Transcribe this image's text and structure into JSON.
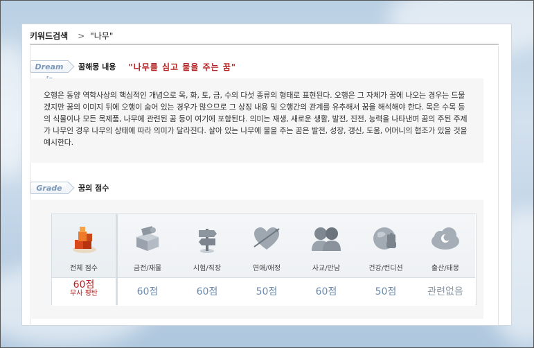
{
  "breadcrumb": {
    "root": "키워드검색",
    "separator": ">",
    "current": "\"나무\""
  },
  "dream": {
    "tag": "Dream is",
    "label": "꿈해몽 내용",
    "title": "\"나무를 심고 물을 주는 꿈\""
  },
  "description": "오행은 동양 역학사상의 핵심적인 개념으로 목, 화, 토, 금, 수의 다섯 종류의 형태로 표현된다. 오행은 그 자체가 꿈에 나오는 경우는 드물겠지만 꿈의 이미지 뒤에 오행이 숨어 있는 경우가 많으므로 그 상징 내용 및 오행간의 관계를 유추해서 꿈을 해석해야 한다. 목은 수목 등의 식물이나 모든 목제품, 나무에 관련된 꿈 등이 여기에 포함된다. 의미는 재생, 새로운 생활, 발전, 진전, 능력을 나타낸며 꿈의 주된 주제가 나무인 경우 나무의 상태에 따라 의미가 달라진다. 살아 있는 나무에 물을 주는 꿈은 발전, 성장, 갱신, 도움, 어머니의 협조가 있을 것을 예시한다.",
  "grade": {
    "tag": "Grade",
    "label": "꿈의 점수",
    "total": {
      "label": "전체 점수",
      "score": "60점",
      "remark": "무사 평탄",
      "icon": "blocks-icon"
    },
    "categories": [
      {
        "label": "금전/재물",
        "score": "60점",
        "icon": "money-box-icon"
      },
      {
        "label": "시험/직장",
        "score": "60점",
        "icon": "signpost-icon"
      },
      {
        "label": "연애/애정",
        "score": "50점",
        "icon": "heart-arrow-icon"
      },
      {
        "label": "사교/만남",
        "score": "60점",
        "icon": "people-icon"
      },
      {
        "label": "건강/컨디션",
        "score": "50점",
        "icon": "globe-hand-icon"
      },
      {
        "label": "출산/태몽",
        "score": "관련없음",
        "icon": "cloud-moon-icon"
      }
    ]
  },
  "colors": {
    "accent_red": "#b52020",
    "score_blue": "#6a8aad",
    "tag_blue": "#7b97b8"
  }
}
